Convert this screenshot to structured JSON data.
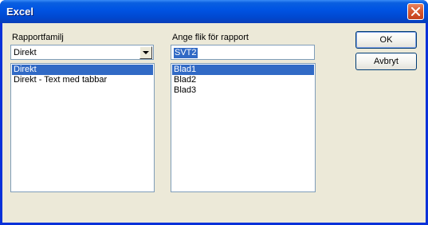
{
  "window": {
    "title": "Excel",
    "close_icon": "close-icon"
  },
  "report_family": {
    "label": "Rapportfamilj",
    "selected": "Direkt",
    "items": [
      {
        "label": "Direkt",
        "selected": true
      },
      {
        "label": "Direkt - Text med tabbar",
        "selected": false
      }
    ]
  },
  "sheet": {
    "label": "Ange flik för rapport",
    "value": "SVT2",
    "items": [
      {
        "label": "Blad1",
        "selected": true
      },
      {
        "label": "Blad2",
        "selected": false
      },
      {
        "label": "Blad3",
        "selected": false
      }
    ]
  },
  "buttons": {
    "ok": "OK",
    "cancel": "Avbryt"
  },
  "colors": {
    "titlebar": "#0054e3",
    "selection": "#316ac5",
    "dialog_bg": "#ece9d8"
  }
}
